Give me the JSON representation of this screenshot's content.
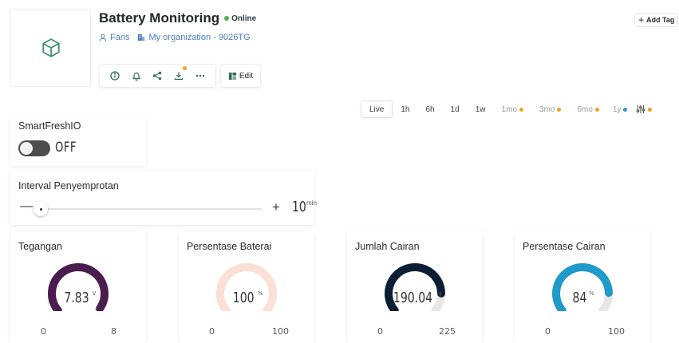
{
  "header": {
    "title": "Battery Monitoring",
    "status": "Online",
    "status_color": "#4caf50",
    "owner": "Faris",
    "organization": "My organization - 9026TG",
    "edit_label": "Edit",
    "add_tag_label": "Add Tag",
    "toolbar_icons": [
      "info-icon",
      "bell-icon",
      "share-icon",
      "download-icon",
      "more-icon"
    ]
  },
  "time_range": {
    "active": "Live",
    "options": [
      {
        "label": "Live"
      },
      {
        "label": "1h"
      },
      {
        "label": "6h"
      },
      {
        "label": "1d"
      },
      {
        "label": "1w"
      },
      {
        "label": "1mo",
        "dot": "#f4a11a"
      },
      {
        "label": "3mo",
        "dot": "#f4a11a"
      },
      {
        "label": "6mo",
        "dot": "#f4a11a"
      },
      {
        "label": "1y",
        "dot": "#2f8fd8"
      }
    ],
    "filter_dot": "#f4a11a"
  },
  "widgets": {
    "switch": {
      "title": "SmartFreshIO",
      "state_label": "OFF"
    },
    "slider": {
      "title": "Interval Penyemprotan",
      "value": "10",
      "unit": "min",
      "fraction": 0.0
    },
    "gauges": [
      {
        "title": "Tegangan",
        "value": "7.83",
        "unit": "V",
        "min": "0",
        "max": "8",
        "fraction": 0.979,
        "color": "#4a1d4f",
        "track": "#e6e6e6"
      },
      {
        "title": "Persentase Baterai",
        "value": "100",
        "unit": "%",
        "min": "0",
        "max": "100",
        "fraction": 1.0,
        "color": "#fbe0d6",
        "track": "#fbe0d6"
      },
      {
        "title": "Jumlah Cairan",
        "value": "190.04",
        "unit": "g",
        "min": "0",
        "max": "225",
        "fraction": 0.845,
        "color": "#0c1e33",
        "track": "#e6e6e6"
      },
      {
        "title": "Persentase Cairan",
        "value": "84",
        "unit": "%",
        "min": "0",
        "max": "100",
        "fraction": 0.84,
        "color": "#1f9ac9",
        "track": "#e6e6e6"
      }
    ]
  }
}
